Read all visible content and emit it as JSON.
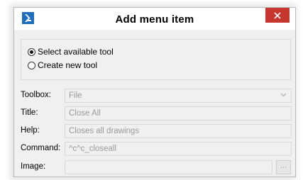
{
  "window": {
    "title": "Add menu item",
    "app_icon": "bricscad-logo-icon",
    "close_icon": "close-icon"
  },
  "tool_choice": {
    "options": [
      {
        "label": "Select available tool",
        "selected": true
      },
      {
        "label": "Create new tool",
        "selected": false
      }
    ]
  },
  "form": {
    "toolbox": {
      "label": "Toolbox:",
      "value": "File",
      "icon": "chevron-down-icon"
    },
    "title": {
      "label": "Title:",
      "value": "Close All"
    },
    "help": {
      "label": "Help:",
      "value": "Closes all drawings"
    },
    "command": {
      "label": "Command:",
      "value": "^c^c_closeall"
    },
    "image": {
      "label": "Image:",
      "value": "",
      "browse_label": "..."
    }
  },
  "colors": {
    "close_button": "#c7362f",
    "app_icon": "#1f6fc1",
    "dialog_bg": "#f0f0f0"
  }
}
